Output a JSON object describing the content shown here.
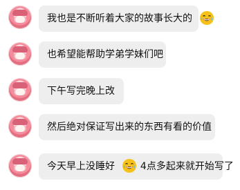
{
  "messages": [
    {
      "text": "我也是不断听着大家的故事长大的",
      "emoji": "laughing-tears-face"
    },
    {
      "text": "也希望能帮助学弟学妹们吧"
    },
    {
      "text": "下午写完晚上改"
    },
    {
      "text": "然后绝对保证写出来的东西有看的价值"
    },
    {
      "text_before": "今天早上没睡好",
      "emoji": "laughing-tears-face",
      "text_after": "4点多起来就开始写了"
    }
  ],
  "colors": {
    "bubble_background": "#eeeeee",
    "text": "#111111",
    "emoji_yellow": "#f6c21a"
  }
}
